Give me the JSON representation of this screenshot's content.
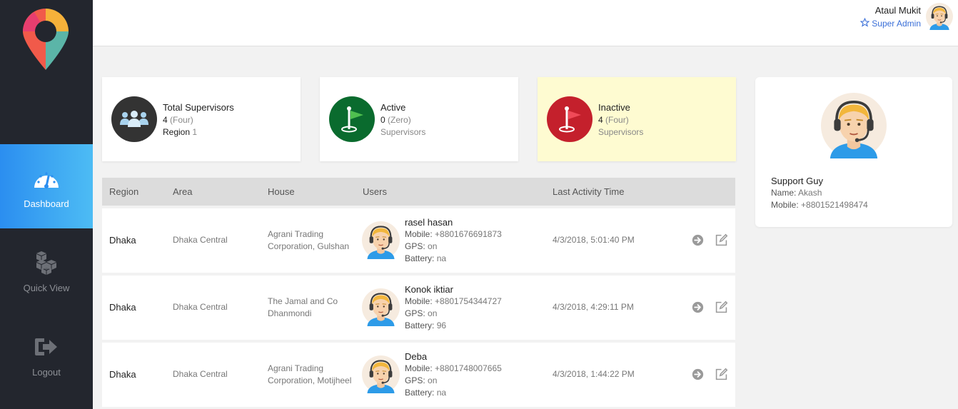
{
  "sidebar": {
    "items": [
      {
        "label": "Dashboard",
        "icon": "speedometer-icon",
        "active": true
      },
      {
        "label": "Quick View",
        "icon": "cubes-icon",
        "active": false
      },
      {
        "label": "Logout",
        "icon": "logout-icon",
        "active": false
      }
    ]
  },
  "header": {
    "user_name": "Ataul Mukit",
    "user_role": "Super Admin"
  },
  "cards": [
    {
      "title": "Total Supervisors",
      "count": "4",
      "count_words": "(Four)",
      "line2_label": "Region",
      "line2_value": "1"
    },
    {
      "title": "Active",
      "count": "0",
      "count_words": "(Zero)",
      "line2_label": "Supervisors",
      "line2_value": ""
    },
    {
      "title": "Inactive",
      "count": "4",
      "count_words": "(Four)",
      "line2_label": "Supervisors",
      "line2_value": ""
    }
  ],
  "table": {
    "headers": [
      "Region",
      "Area",
      "House",
      "Users",
      "Last Activity Time"
    ],
    "rows": [
      {
        "region": "Dhaka",
        "area": "Dhaka Central",
        "house": "Agrani Trading Corporation, Gulshan",
        "user_name": "rasel hasan",
        "mobile_label": "Mobile:",
        "mobile": "+8801676691873",
        "gps_label": "GPS:",
        "gps": "on",
        "battery_label": "Battery:",
        "battery": "na",
        "time": "4/3/2018, 5:01:40 PM"
      },
      {
        "region": "Dhaka",
        "area": "Dhaka Central",
        "house": "The Jamal and Co Dhanmondi",
        "user_name": "Konok iktiar",
        "mobile_label": "Mobile:",
        "mobile": "+8801754344727",
        "gps_label": "GPS:",
        "gps": "on",
        "battery_label": "Battery:",
        "battery": "96",
        "time": "4/3/2018, 4:29:11 PM"
      },
      {
        "region": "Dhaka",
        "area": "Dhaka Central",
        "house": "Agrani Trading Corporation, Motijheel",
        "user_name": "Deba",
        "mobile_label": "Mobile:",
        "mobile": "+8801748007665",
        "gps_label": "GPS:",
        "gps": "on",
        "battery_label": "Battery:",
        "battery": "na",
        "time": "4/3/2018, 1:44:22 PM"
      }
    ]
  },
  "support": {
    "title": "Support Guy",
    "name_label": "Name:",
    "name": "Akash",
    "mobile_label": "Mobile:",
    "mobile": "+8801521498474"
  },
  "colors": {
    "sidebar_bg": "#23262e",
    "active_nav": "#2b8ef0",
    "total_circle": "#333333",
    "active_circle": "#0a6b2e",
    "inactive_circle": "#c4202c",
    "inactive_card_bg": "#fefbd1"
  }
}
